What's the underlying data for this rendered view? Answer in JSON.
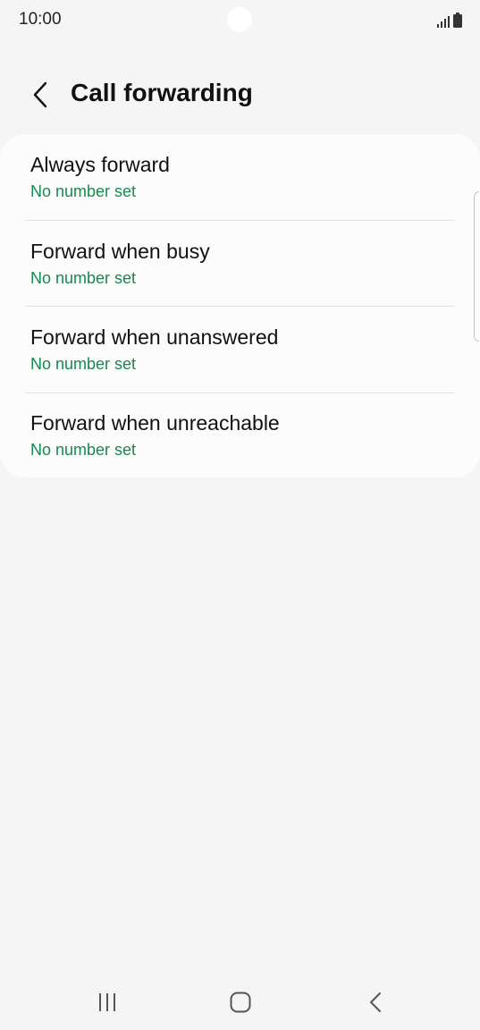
{
  "status_bar": {
    "time": "10:00"
  },
  "header": {
    "title": "Call forwarding",
    "back_icon": "chevron-left-icon"
  },
  "forwarding_options": [
    {
      "title": "Always forward",
      "subtitle": "No number set"
    },
    {
      "title": "Forward when busy",
      "subtitle": "No number set"
    },
    {
      "title": "Forward when unanswered",
      "subtitle": "No number set"
    },
    {
      "title": "Forward when unreachable",
      "subtitle": "No number set"
    }
  ],
  "navigation_bar": {
    "recents_icon": "recent-apps-icon",
    "home_icon": "home-icon",
    "back_icon": "back-icon"
  },
  "colors": {
    "background": "#f5f5f5",
    "card": "#fcfcfc",
    "accent_green": "#168a4f",
    "text_primary": "#111111"
  }
}
